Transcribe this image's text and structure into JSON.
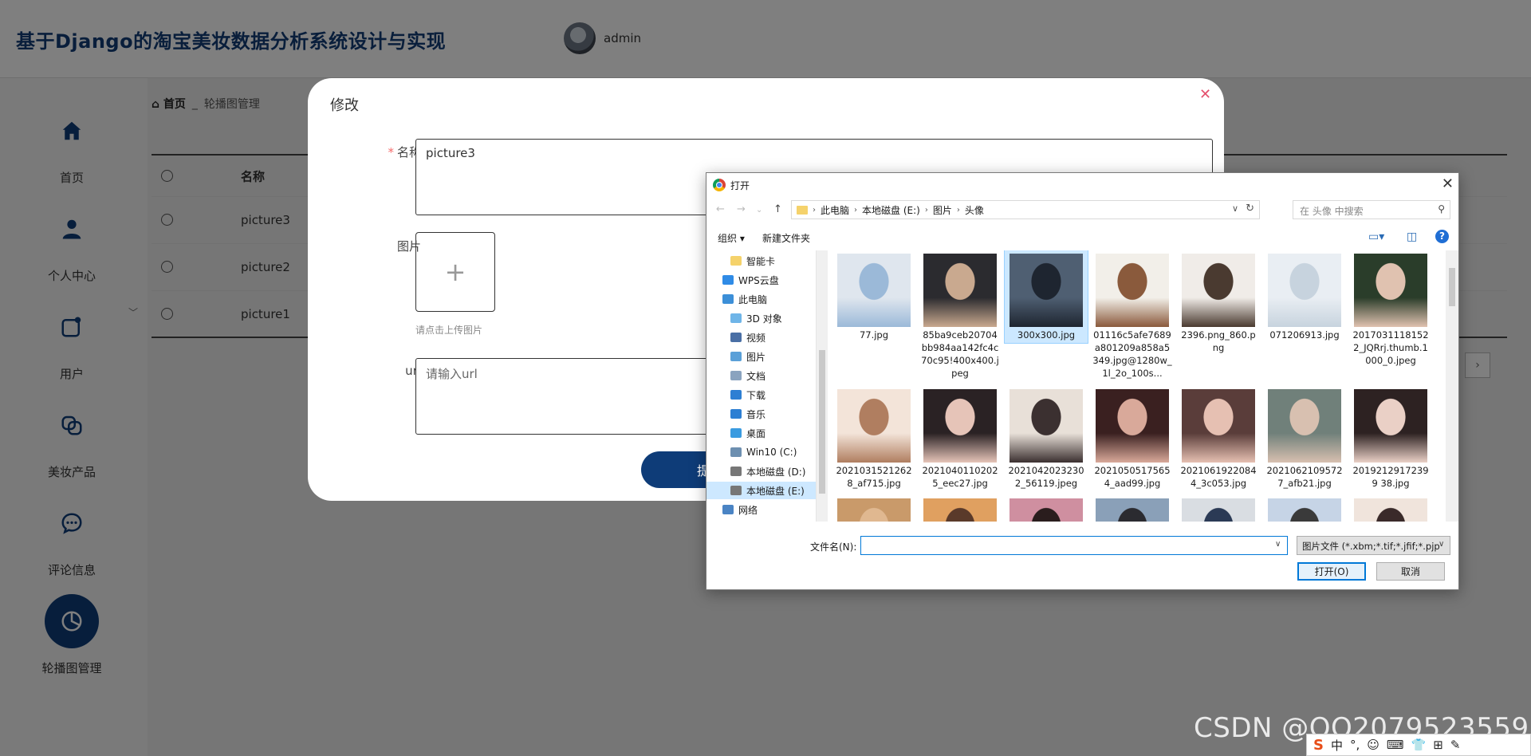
{
  "app": {
    "title": "基于Django的淘宝美妆数据分析系统设计与实现",
    "user": "admin"
  },
  "sidebar": {
    "items": [
      {
        "label": "首页",
        "icon": "home-icon",
        "top": 0
      },
      {
        "label": "个人中心",
        "icon": "person-icon"
      },
      {
        "label": "用户",
        "icon": "user-card-icon"
      },
      {
        "label": "美妆产品",
        "icon": "product-icon"
      },
      {
        "label": "评论信息",
        "icon": "comment-icon"
      },
      {
        "label": "轮播图管理",
        "icon": "pie-chart-icon",
        "active": true
      }
    ]
  },
  "breadcrumb": {
    "home": "首页",
    "separator": "_",
    "current": "轮播图管理"
  },
  "table": {
    "headers": [
      "",
      "名称"
    ],
    "rows": [
      "picture3",
      "picture2",
      "picture1"
    ]
  },
  "modal": {
    "title": "修改",
    "name_label": "名称",
    "name_value": "picture3",
    "image_label": "图片",
    "upload_plus": "+",
    "upload_hint": "请点击上传图片",
    "url_label": "url",
    "url_placeholder": "请输入url",
    "submit_label": "提"
  },
  "file_dialog": {
    "title": "打开",
    "path": [
      "此电脑",
      "本地磁盘 (E:)",
      "图片",
      "头像"
    ],
    "search_placeholder": "在 头像 中搜索",
    "commands": {
      "organize": "组织 ▾",
      "new_folder": "新建文件夹"
    },
    "tree": [
      {
        "label": "智能卡",
        "color": "#f5d26b"
      },
      {
        "label": "WPS云盘",
        "color": "#2f8be6"
      },
      {
        "label": "此电脑",
        "color": "#3c8fd8"
      },
      {
        "label": "3D 对象",
        "color": "#6fb5e8"
      },
      {
        "label": "视频",
        "color": "#4a6fa5"
      },
      {
        "label": "图片",
        "color": "#5aa0d8"
      },
      {
        "label": "文档",
        "color": "#8aa3bf"
      },
      {
        "label": "下载",
        "color": "#2d7fd3"
      },
      {
        "label": "音乐",
        "color": "#2d7fd3"
      },
      {
        "label": "桌面",
        "color": "#3a9be0"
      },
      {
        "label": "Win10 (C:)",
        "color": "#6d8fb0"
      },
      {
        "label": "本地磁盘 (D:)",
        "color": "#777"
      },
      {
        "label": "本地磁盘 (E:)",
        "color": "#777",
        "selected": true
      },
      {
        "label": "网络",
        "color": "#4a84c4"
      }
    ],
    "files": [
      {
        "name": "77.jpg",
        "c1": "#dfe6ee",
        "c2": "#9bb9d8"
      },
      {
        "name": "85ba9ceb20704bb984aa142fc4c70c95!400x400.jpeg",
        "c1": "#2b2b2f",
        "c2": "#c9a98f"
      },
      {
        "name": "300x300.jpg",
        "c1": "#4f5f72",
        "c2": "#1e2530",
        "selected": true
      },
      {
        "name": "01116c5afe7689a801209a858a5349.jpg@1280w_1l_2o_100s...",
        "c1": "#f2efe9",
        "c2": "#8a5a3c"
      },
      {
        "name": "2396.png_860.png",
        "c1": "#f0ece8",
        "c2": "#4a3a30"
      },
      {
        "name": "071206913.jpg",
        "c1": "#e9eef3",
        "c2": "#c7d3de"
      },
      {
        "name": "20170311181522_JQRrj.thumb.1000_0.jpeg",
        "c1": "#2a3d2a",
        "c2": "#e0c2b0"
      },
      {
        "name": "20210315212628_af715.jpg",
        "c1": "#f3e4d9",
        "c2": "#b07e60"
      },
      {
        "name": "20210401102025_eec27.jpg",
        "c1": "#2a2224",
        "c2": "#e6c4b8"
      },
      {
        "name": "20210420232302_56119.jpeg",
        "c1": "#e8e0d8",
        "c2": "#3b3030"
      },
      {
        "name": "20210505175654_aad99.jpg",
        "c1": "#3a2020",
        "c2": "#d9a99a"
      },
      {
        "name": "20210619220844_3c053.jpg",
        "c1": "#5a3d3a",
        "c2": "#e6c0b2"
      },
      {
        "name": "20210621095727_afb21.jpg",
        "c1": "#70807a",
        "c2": "#d8c0b0"
      },
      {
        "name": "20192129172399 38.jpg",
        "c1": "#2d2222",
        "c2": "#ead0c6"
      },
      {
        "name": "",
        "c1": "#c99a6a",
        "c2": "#e0b890"
      },
      {
        "name": "",
        "c1": "#e0a060",
        "c2": "#5a3a2a"
      },
      {
        "name": "",
        "c1": "#cf8fa0",
        "c2": "#2a1d1d"
      },
      {
        "name": "",
        "c1": "#8aa0b8",
        "c2": "#2b2b30"
      },
      {
        "name": "",
        "c1": "#d9dde2",
        "c2": "#2b3a55"
      },
      {
        "name": "",
        "c1": "#c6d4e6",
        "c2": "#3a3a3a"
      },
      {
        "name": "",
        "c1": "#f0e4dc",
        "c2": "#3a2a2a"
      }
    ],
    "filename_label": "文件名(N):",
    "filename_value": "",
    "filetype": "图片文件 (*.xbm;*.tif;*.jfif;*.pjp",
    "open_label": "打开(O)",
    "cancel_label": "取消"
  },
  "watermark": "CSDN @QQ2079523559",
  "ime": [
    "S",
    "中",
    "°,",
    "☺",
    "⌨",
    "👕",
    "⊞",
    "✎"
  ]
}
